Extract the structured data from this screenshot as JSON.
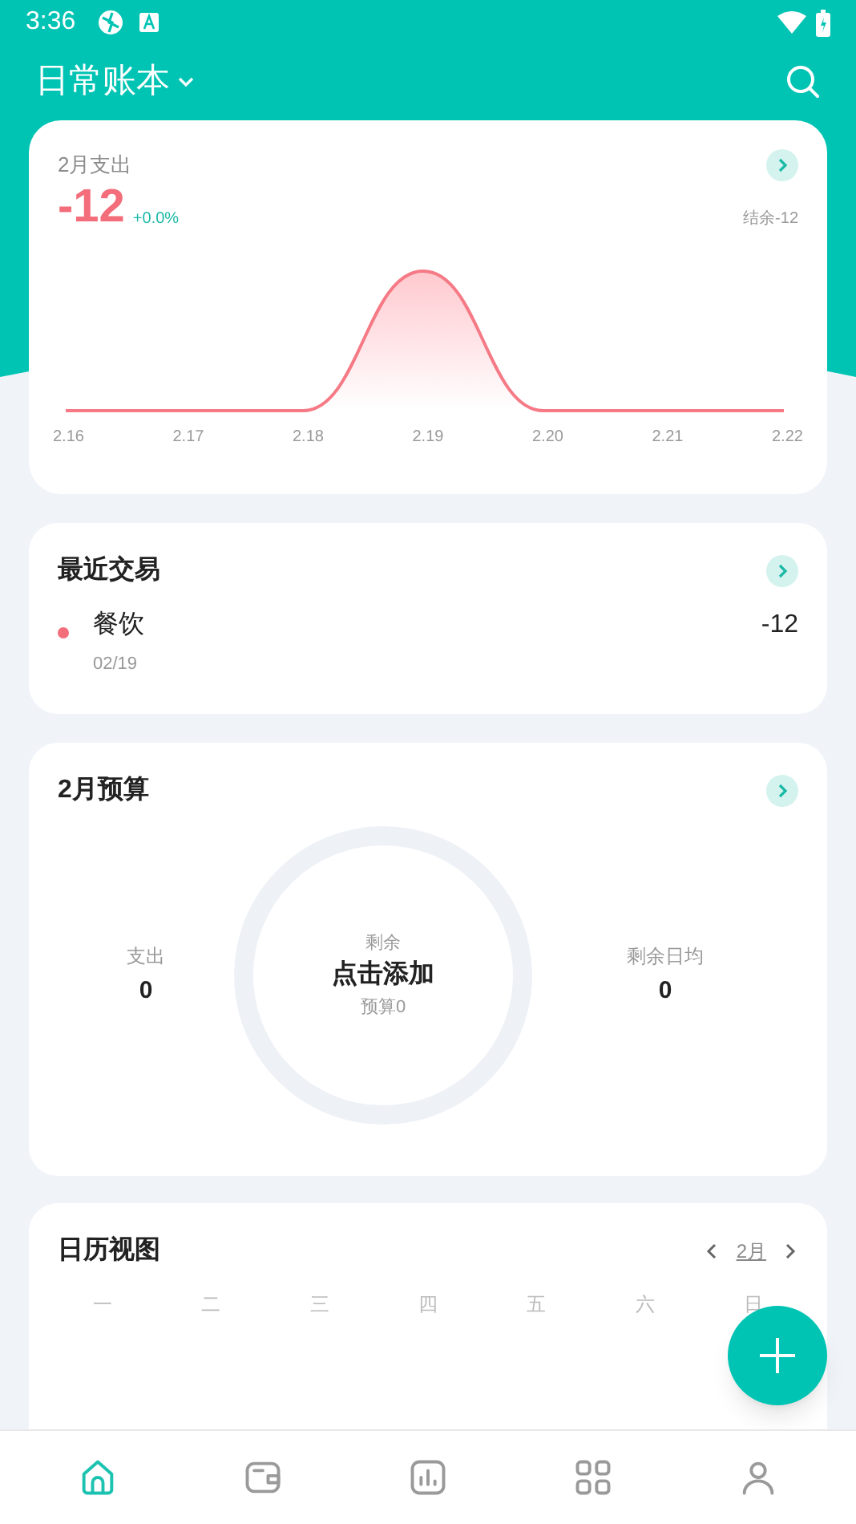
{
  "status_bar": {
    "time": "3:36"
  },
  "header": {
    "title": "日常账本"
  },
  "expense_card": {
    "title": "2月支出",
    "amount": "-12",
    "change": "+0.0%",
    "balance": "结余-12",
    "x_labels": [
      "2.16",
      "2.17",
      "2.18",
      "2.19",
      "2.20",
      "2.21",
      "2.22"
    ]
  },
  "recent": {
    "title": "最近交易",
    "items": [
      {
        "category": "餐饮",
        "date": "02/19",
        "amount": "-12",
        "color": "#f36d7b"
      }
    ]
  },
  "budget": {
    "title": "2月预算",
    "left_label": "支出",
    "left_value": "0",
    "center_caption": "剩余",
    "center_action": "点击添加",
    "center_sub": "预算0",
    "right_label": "剩余日均",
    "right_value": "0"
  },
  "calendar": {
    "title": "日历视图",
    "month": "2月",
    "weekdays": [
      "一",
      "二",
      "三",
      "四",
      "五",
      "六",
      "日"
    ]
  },
  "bottom_nav": [
    {
      "kind": "home",
      "selected": true
    },
    {
      "kind": "wallet",
      "selected": false
    },
    {
      "kind": "chart",
      "selected": false
    },
    {
      "kind": "grid",
      "selected": false
    },
    {
      "kind": "person",
      "selected": false
    }
  ]
}
